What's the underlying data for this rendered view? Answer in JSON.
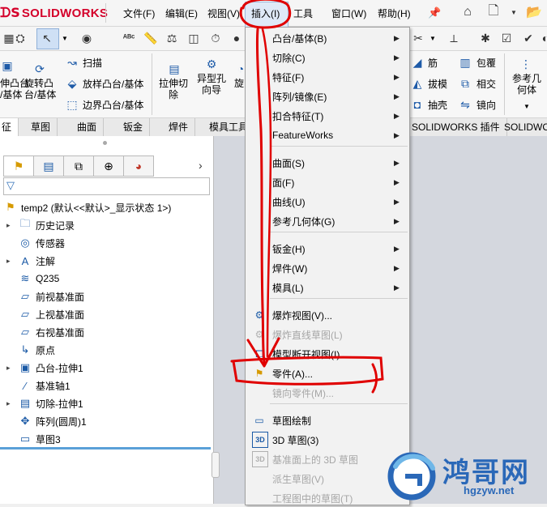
{
  "app": {
    "logo_ds": "ᗪS",
    "logo_name": "SOLIDWORKS"
  },
  "menubar": {
    "items": [
      "文件(F)",
      "编辑(E)",
      "视图(V)",
      "插入(I)",
      "工具",
      "窗口(W)",
      "帮助(H)"
    ]
  },
  "command_manager": {
    "left_group": {
      "a": "伸凸台\n/基体",
      "b": "旋转凸\n台/基体"
    },
    "sweep": "扫描",
    "loft": "放样凸台/基体",
    "boundary": "边界凸台/基体",
    "extrude_cut": "拉伸切\n除",
    "hole_wizard": "异型孔\n向导",
    "revolve_cut": "旋",
    "rib": "筋",
    "wrap": "包覆",
    "draft": "拔模",
    "intersect": "相交",
    "shell": "抽壳",
    "mirror": "镜向",
    "ref_geometry": "参考几\n何体"
  },
  "tabs": [
    "征",
    "草图",
    "曲面",
    "钣金",
    "焊件",
    "模具工具",
    "SOLIDWORKS 插件",
    "SOLIDWO"
  ],
  "feature_manager": {
    "root": "temp2 (默认<<默认>_显示状态 1>)",
    "items": [
      {
        "label": "历史记录",
        "expand": true,
        "icon": "history-folder-icon"
      },
      {
        "label": "传感器",
        "expand": false,
        "icon": "sensor-icon"
      },
      {
        "label": "注解",
        "expand": true,
        "icon": "annotation-icon"
      },
      {
        "label": "Q235",
        "expand": false,
        "icon": "material-icon"
      },
      {
        "label": "前视基准面",
        "expand": false,
        "icon": "plane-icon"
      },
      {
        "label": "上视基准面",
        "expand": false,
        "icon": "plane-icon"
      },
      {
        "label": "右视基准面",
        "expand": false,
        "icon": "plane-icon"
      },
      {
        "label": "原点",
        "expand": false,
        "icon": "origin-icon"
      },
      {
        "label": "凸台-拉伸1",
        "expand": true,
        "icon": "boss-extrude-icon"
      },
      {
        "label": "基准轴1",
        "expand": false,
        "icon": "axis-icon"
      },
      {
        "label": "切除-拉伸1",
        "expand": true,
        "icon": "cut-extrude-icon"
      },
      {
        "label": "阵列(圆周)1",
        "expand": false,
        "icon": "circular-pattern-icon"
      },
      {
        "label": "草图3",
        "expand": false,
        "icon": "sketch-icon"
      }
    ]
  },
  "insert_menu": {
    "items": [
      {
        "label": "凸台/基体(B)",
        "submenu": true,
        "disabled": false
      },
      {
        "label": "切除(C)",
        "submenu": true,
        "disabled": false
      },
      {
        "label": "特征(F)",
        "submenu": true,
        "disabled": false
      },
      {
        "label": "阵列/镜像(E)",
        "submenu": true,
        "disabled": false
      },
      {
        "label": "扣合特征(T)",
        "submenu": true,
        "disabled": false
      },
      {
        "label": "FeatureWorks",
        "submenu": true,
        "disabled": false
      },
      {
        "label": "曲面(S)",
        "submenu": true,
        "disabled": false
      },
      {
        "label": "面(F)",
        "submenu": true,
        "disabled": false
      },
      {
        "label": "曲线(U)",
        "submenu": true,
        "disabled": false
      },
      {
        "label": "参考几何体(G)",
        "submenu": true,
        "disabled": false
      },
      {
        "label": "钣金(H)",
        "submenu": true,
        "disabled": false
      },
      {
        "label": "焊件(W)",
        "submenu": true,
        "disabled": false
      },
      {
        "label": "模具(L)",
        "submenu": true,
        "disabled": false
      },
      {
        "label": "爆炸视图(V)...",
        "submenu": false,
        "disabled": false
      },
      {
        "label": "爆炸直线草图(L)",
        "submenu": false,
        "disabled": true
      },
      {
        "label": "模型断开视图(I)",
        "submenu": false,
        "disabled": false
      },
      {
        "label": "零件(A)...",
        "submenu": false,
        "disabled": false
      },
      {
        "label": "镜向零件(M)...",
        "submenu": false,
        "disabled": true
      },
      {
        "label": "草图绘制",
        "submenu": false,
        "disabled": false
      },
      {
        "label": "3D 草图(3)",
        "submenu": false,
        "disabled": false
      },
      {
        "label": "基准面上的 3D 草图",
        "submenu": false,
        "disabled": true
      },
      {
        "label": "派生草图(V)",
        "submenu": false,
        "disabled": true
      },
      {
        "label": "工程图中的草图(T)",
        "submenu": false,
        "disabled": true
      }
    ]
  },
  "watermark": {
    "title": "鸿哥网",
    "url": "hgzyw.net"
  },
  "colors": {
    "accent": "#d4002a",
    "annotation": "#e00000",
    "watermark": "#2a68b8"
  }
}
